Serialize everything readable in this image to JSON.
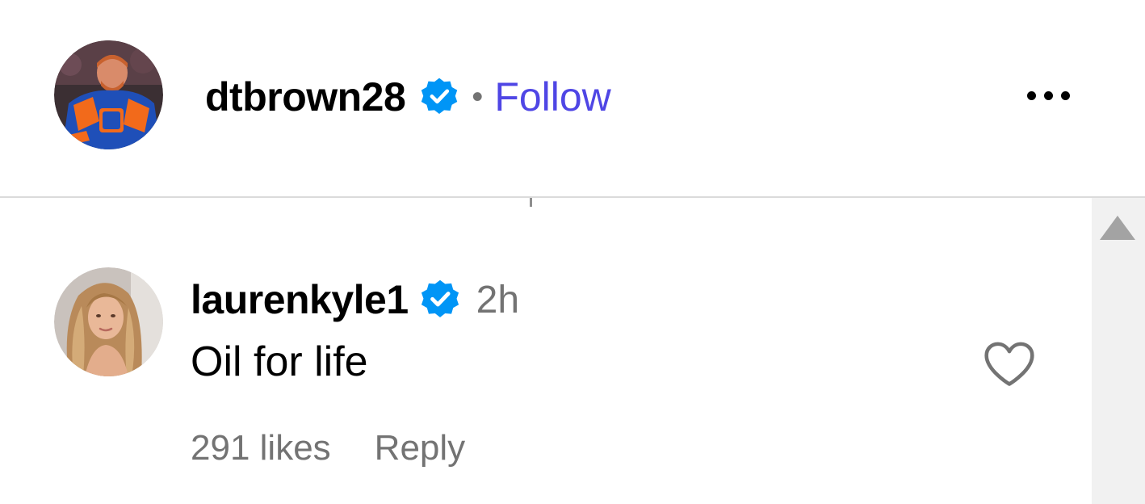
{
  "post": {
    "username": "dtbrown28",
    "verified_icon": "verified-badge-icon",
    "separator": "•",
    "follow_label": "Follow",
    "more_icon": "more-options-icon"
  },
  "comment": {
    "username": "laurenkyle1",
    "verified_icon": "verified-badge-icon",
    "timestamp": "2h",
    "text": "Oil for life",
    "likes": "291 likes",
    "reply_label": "Reply",
    "like_icon": "heart-outline-icon"
  },
  "scrollbar": {
    "up_icon": "scroll-up-arrow-icon"
  },
  "colors": {
    "follow": "#4f46e5",
    "verified": "#0095f6",
    "muted_text": "#737373",
    "divider": "#dbdbdb",
    "scrollbar_track": "#f1f1f1"
  }
}
